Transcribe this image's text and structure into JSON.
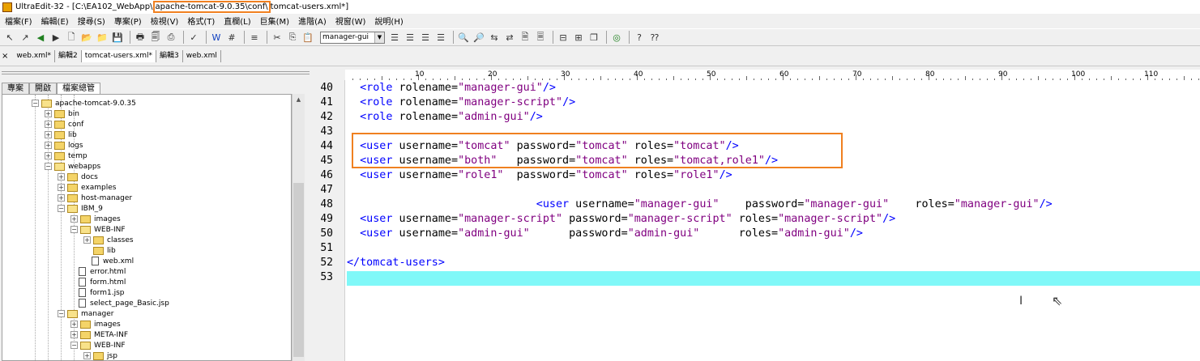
{
  "window": {
    "title_prefix": "UltraEdit-32 - [C:\\EA102_WebApp\\",
    "title_highlight": "apache-tomcat-9.0.35\\conf\\",
    "title_suffix": "tomcat-users.xml*]"
  },
  "menu": [
    "檔案(F)",
    "編輯(E)",
    "搜尋(S)",
    "專案(P)",
    "檢視(V)",
    "格式(T)",
    "直欄(L)",
    "巨集(M)",
    "進階(A)",
    "視窗(W)",
    "說明(H)"
  ],
  "toolbar": {
    "function_combo": "manager-gui"
  },
  "tabs": [
    "web.xml*",
    "編輯2",
    "tomcat-users.xml*",
    "編輯3",
    "web.xml"
  ],
  "pane_tabs": [
    "專案",
    "開啟",
    "檔案總管"
  ],
  "tree": [
    {
      "label": "apache-tomcat-9.0.35",
      "kind": "folder-open",
      "level": 0
    },
    {
      "label": "bin",
      "kind": "folder",
      "level": 1
    },
    {
      "label": "conf",
      "kind": "folder",
      "level": 1
    },
    {
      "label": "lib",
      "kind": "folder",
      "level": 1
    },
    {
      "label": "logs",
      "kind": "folder",
      "level": 1
    },
    {
      "label": "temp",
      "kind": "folder",
      "level": 1
    },
    {
      "label": "webapps",
      "kind": "folder-open",
      "level": 1
    },
    {
      "label": "docs",
      "kind": "folder",
      "level": 2
    },
    {
      "label": "examples",
      "kind": "folder",
      "level": 2
    },
    {
      "label": "host-manager",
      "kind": "folder",
      "level": 2
    },
    {
      "label": "IBM_9",
      "kind": "folder-open",
      "level": 2
    },
    {
      "label": "images",
      "kind": "folder",
      "level": 3
    },
    {
      "label": "WEB-INF",
      "kind": "folder-open",
      "level": 3
    },
    {
      "label": "classes",
      "kind": "folder",
      "level": 4
    },
    {
      "label": "lib",
      "kind": "folder-leaf",
      "level": 4
    },
    {
      "label": "web.xml",
      "kind": "file",
      "level": 4
    },
    {
      "label": "error.html",
      "kind": "file",
      "level": 3
    },
    {
      "label": "form.html",
      "kind": "file",
      "level": 3
    },
    {
      "label": "form1.jsp",
      "kind": "file",
      "level": 3
    },
    {
      "label": "select_page_Basic.jsp",
      "kind": "file",
      "level": 3
    },
    {
      "label": "manager",
      "kind": "folder-open",
      "level": 2
    },
    {
      "label": "images",
      "kind": "folder",
      "level": 3
    },
    {
      "label": "META-INF",
      "kind": "folder",
      "level": 3
    },
    {
      "label": "WEB-INF",
      "kind": "folder-open",
      "level": 3
    },
    {
      "label": "jsp",
      "kind": "folder",
      "level": 4
    }
  ],
  "ruler_labels": [
    "10",
    "20",
    "30",
    "40",
    "50",
    "60",
    "70",
    "80",
    "90",
    "100",
    "110"
  ],
  "code_lines": [
    {
      "no": "40",
      "indent": "  ",
      "parts": [
        [
          "tg",
          "<role "
        ],
        [
          "str",
          "rolename="
        ],
        [
          "val",
          "\"manager-gui\""
        ],
        [
          "tg",
          "/>"
        ]
      ]
    },
    {
      "no": "41",
      "indent": "  ",
      "parts": [
        [
          "tg",
          "<role "
        ],
        [
          "str",
          "rolename="
        ],
        [
          "val",
          "\"manager-script\""
        ],
        [
          "tg",
          "/>"
        ]
      ]
    },
    {
      "no": "42",
      "indent": "  ",
      "parts": [
        [
          "tg",
          "<role "
        ],
        [
          "str",
          "rolename="
        ],
        [
          "val",
          "\"admin-gui\""
        ],
        [
          "tg",
          "/>"
        ]
      ]
    },
    {
      "no": "43",
      "indent": "",
      "parts": []
    },
    {
      "no": "44",
      "indent": "  ",
      "parts": [
        [
          "tg",
          "<user "
        ],
        [
          "str",
          "username="
        ],
        [
          "val",
          "\"tomcat\""
        ],
        [
          "str",
          " password="
        ],
        [
          "val",
          "\"tomcat\""
        ],
        [
          "str",
          " roles="
        ],
        [
          "val",
          "\"tomcat\""
        ],
        [
          "tg",
          "/>"
        ]
      ]
    },
    {
      "no": "45",
      "indent": "  ",
      "parts": [
        [
          "tg",
          "<user "
        ],
        [
          "str",
          "username="
        ],
        [
          "val",
          "\"both\""
        ],
        [
          "str",
          "   password="
        ],
        [
          "val",
          "\"tomcat\""
        ],
        [
          "str",
          " roles="
        ],
        [
          "val",
          "\"tomcat,role1\""
        ],
        [
          "tg",
          "/>"
        ]
      ]
    },
    {
      "no": "46",
      "indent": "  ",
      "parts": [
        [
          "tg",
          "<user "
        ],
        [
          "str",
          "username="
        ],
        [
          "val",
          "\"role1\""
        ],
        [
          "str",
          "  password="
        ],
        [
          "val",
          "\"tomcat\""
        ],
        [
          "str",
          " roles="
        ],
        [
          "val",
          "\"role1\""
        ],
        [
          "tg",
          "/>"
        ]
      ]
    },
    {
      "no": "47",
      "indent": "",
      "parts": []
    },
    {
      "no": "48",
      "indent": "                             ",
      "parts": [
        [
          "tg",
          "<user "
        ],
        [
          "str",
          "username="
        ],
        [
          "val",
          "\"manager-gui\""
        ],
        [
          "str",
          "    password="
        ],
        [
          "val",
          "\"manager-gui\""
        ],
        [
          "str",
          "    roles="
        ],
        [
          "val",
          "\"manager-gui\""
        ],
        [
          "tg",
          "/>"
        ]
      ]
    },
    {
      "no": "49",
      "indent": "  ",
      "parts": [
        [
          "tg",
          "<user "
        ],
        [
          "str",
          "username="
        ],
        [
          "val",
          "\"manager-script\""
        ],
        [
          "str",
          " password="
        ],
        [
          "val",
          "\"manager-script\""
        ],
        [
          "str",
          " roles="
        ],
        [
          "val",
          "\"manager-script\""
        ],
        [
          "tg",
          "/>"
        ]
      ]
    },
    {
      "no": "50",
      "indent": "  ",
      "parts": [
        [
          "tg",
          "<user "
        ],
        [
          "str",
          "username="
        ],
        [
          "val",
          "\"admin-gui\""
        ],
        [
          "str",
          "      password="
        ],
        [
          "val",
          "\"admin-gui\""
        ],
        [
          "str",
          "      roles="
        ],
        [
          "val",
          "\"admin-gui\""
        ],
        [
          "tg",
          "/>"
        ]
      ]
    },
    {
      "no": "51",
      "indent": "",
      "parts": []
    },
    {
      "no": "52",
      "indent": "",
      "parts": [
        [
          "tg",
          "</tomcat-users>"
        ]
      ]
    },
    {
      "no": "53",
      "indent": "",
      "parts": []
    }
  ],
  "colors": {
    "tag": "#0000ff",
    "value": "#800080",
    "cursor_line": "#80f8f8",
    "highlight_box": "#f08020"
  }
}
